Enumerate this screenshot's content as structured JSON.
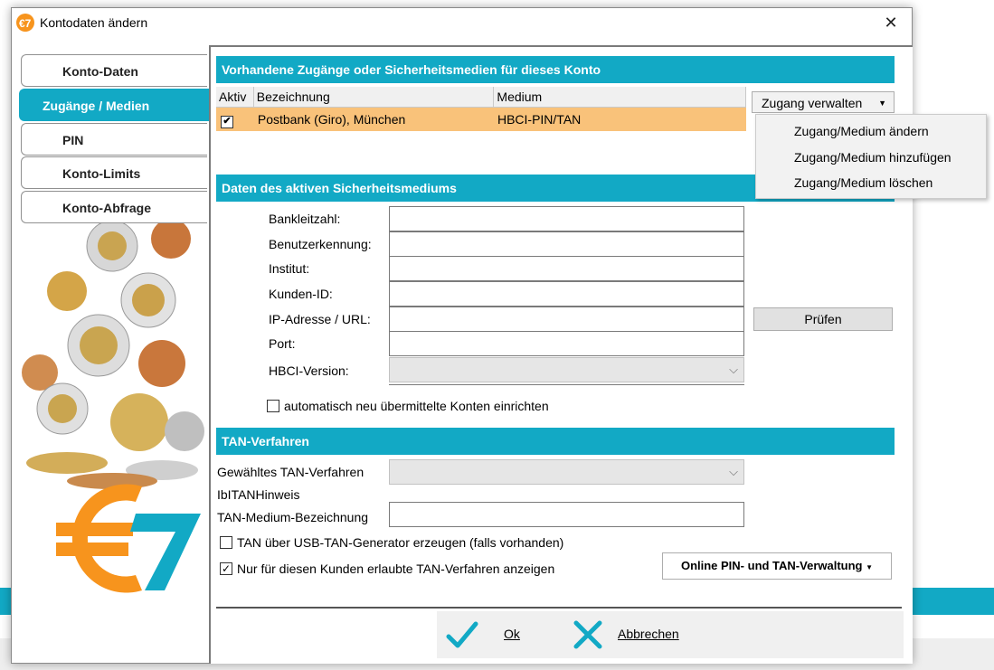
{
  "window": {
    "title": "Kontodaten ändern",
    "close_glyph": "✕"
  },
  "tabs": [
    {
      "label": "Konto-Daten"
    },
    {
      "label": "Zugänge / Medien"
    },
    {
      "label": "PIN"
    },
    {
      "label": "Konto-Limits"
    },
    {
      "label": "Konto-Abfrage"
    }
  ],
  "access_section": {
    "heading": "Vorhandene Zugänge oder Sicherheitsmedien für dieses Konto",
    "columns": {
      "aktiv": "Aktiv",
      "bezeichnung": "Bezeichnung",
      "medium": "Medium"
    },
    "rows": [
      {
        "aktiv_mark": "✔",
        "bezeichnung": "Postbank (Giro), München",
        "medium": "HBCI-PIN/TAN"
      }
    ],
    "manage_button": "Zugang verwalten",
    "manage_menu": [
      "Zugang/Medium ändern",
      "Zugang/Medium hinzufügen",
      "Zugang/Medium löschen"
    ]
  },
  "medium_section": {
    "heading": "Daten des aktiven Sicherheitsmediums",
    "fields": {
      "bankleitzahl": "Bankleitzahl:",
      "benutzerkennung": "Benutzerkennung:",
      "institut": "Institut:",
      "kunden_id": "Kunden-ID:",
      "ip_url": "IP-Adresse / URL:",
      "port": "Port:",
      "hbci_version": "HBCI-Version:"
    },
    "pruefen_button": "Prüfen",
    "auto_accounts_label": "automatisch neu übermittelte Konten einrichten"
  },
  "tan_section": {
    "heading": "TAN-Verfahren",
    "selected_label": "Gewähltes TAN-Verfahren",
    "hint_label": "IbITANHinweis",
    "medium_label": "TAN-Medium-Bezeichnung",
    "usb_label": "TAN über USB-TAN-Generator erzeugen (falls vorhanden)",
    "only_allowed_label": "Nur für diesen Kunden erlaubte TAN-Verfahren anzeigen",
    "only_allowed_checked_mark": "✓",
    "online_button": "Online PIN- und TAN-Verwaltung"
  },
  "footer": {
    "ok_label": "Ok",
    "cancel_label": "Abbrechen"
  },
  "colors": {
    "accent": "#12a9c5",
    "row_highlight": "#f9c27a",
    "logo_orange": "#f7941d"
  }
}
